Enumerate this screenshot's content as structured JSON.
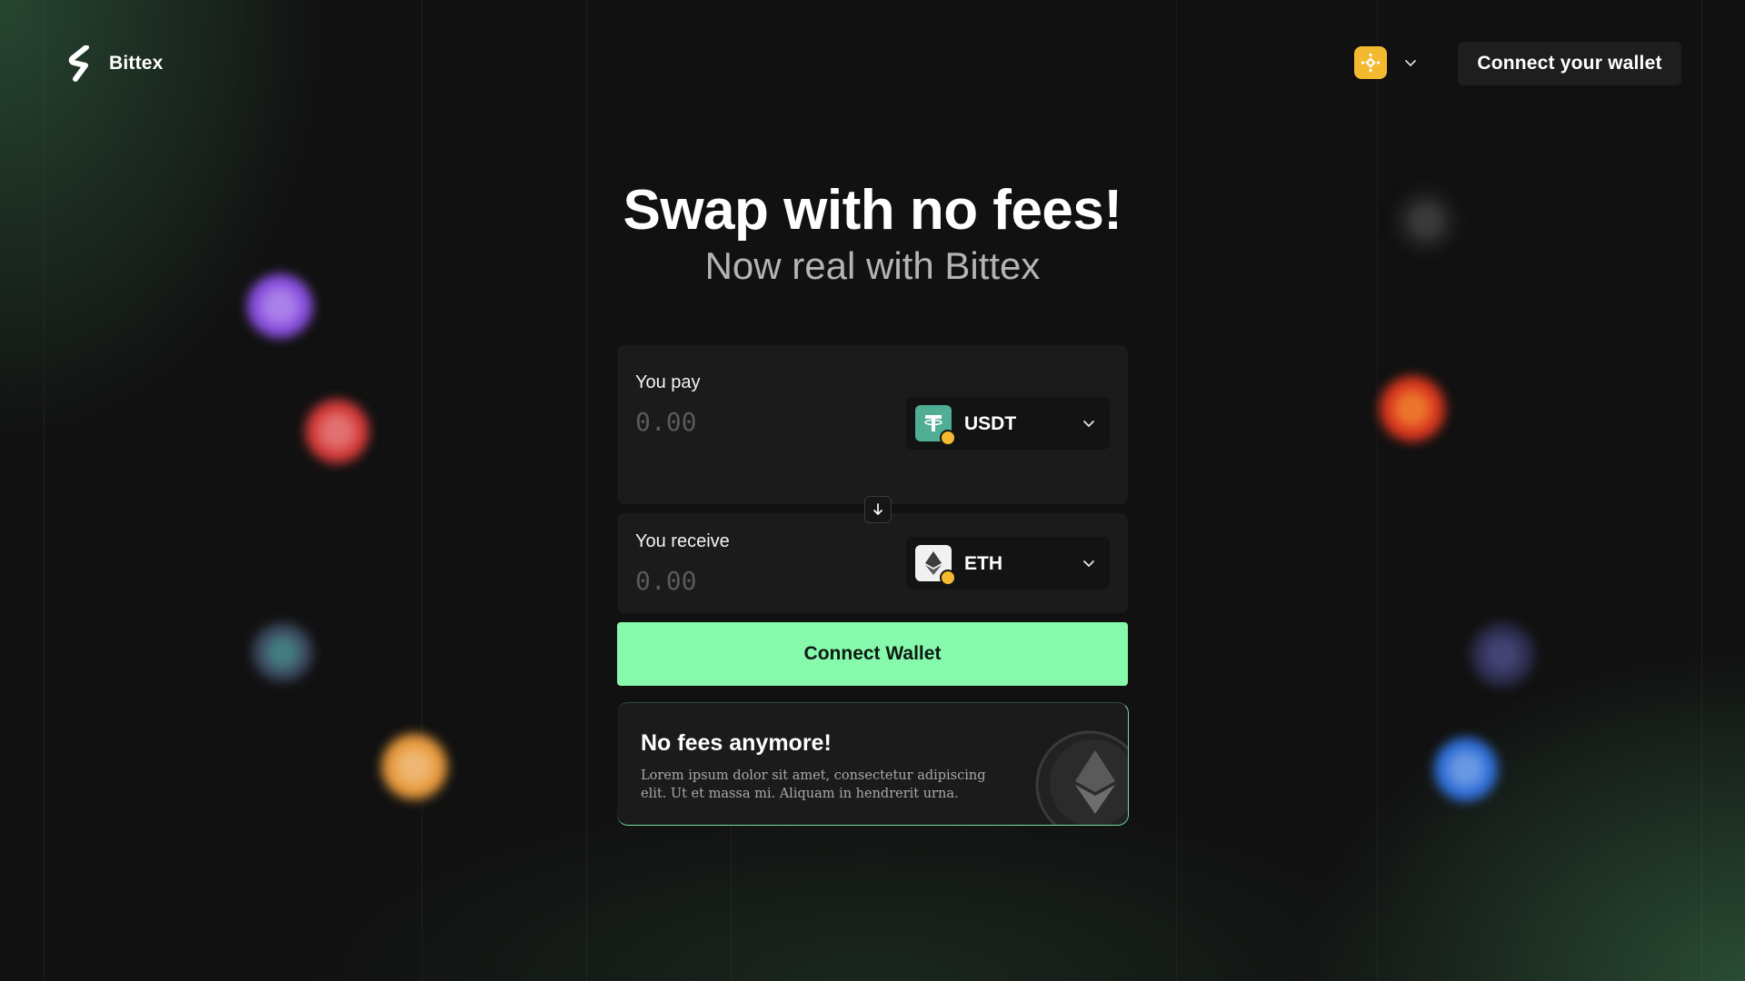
{
  "header": {
    "brand_name": "Bittex",
    "connect_label": "Connect your wallet",
    "chain_icon": "bnb-chain-icon"
  },
  "hero": {
    "title": "Swap with no fees!",
    "subtitle": "Now real with Bittex"
  },
  "swap": {
    "pay": {
      "label": "You pay",
      "placeholder": "0.00",
      "token": {
        "symbol": "USDT",
        "icon": "usdt-icon",
        "color": "#4fae93"
      }
    },
    "receive": {
      "label": "You receive",
      "placeholder": "0.00",
      "token": {
        "symbol": "ETH",
        "icon": "eth-icon",
        "color": "#f1f1f1"
      }
    },
    "direction_icon": "arrow-down-icon",
    "connect_label": "Connect Wallet"
  },
  "info_card": {
    "title": "No fees anymore!",
    "text": "Lorem ipsum dolor sit amet, consectetur adipiscing elit. Ut et massa mi. Aliquam in hendrerit urna."
  },
  "colors": {
    "accent": "#86f9ad",
    "background": "#111111",
    "panel": "#1b1b1b",
    "bnb": "#f3ba2f"
  }
}
